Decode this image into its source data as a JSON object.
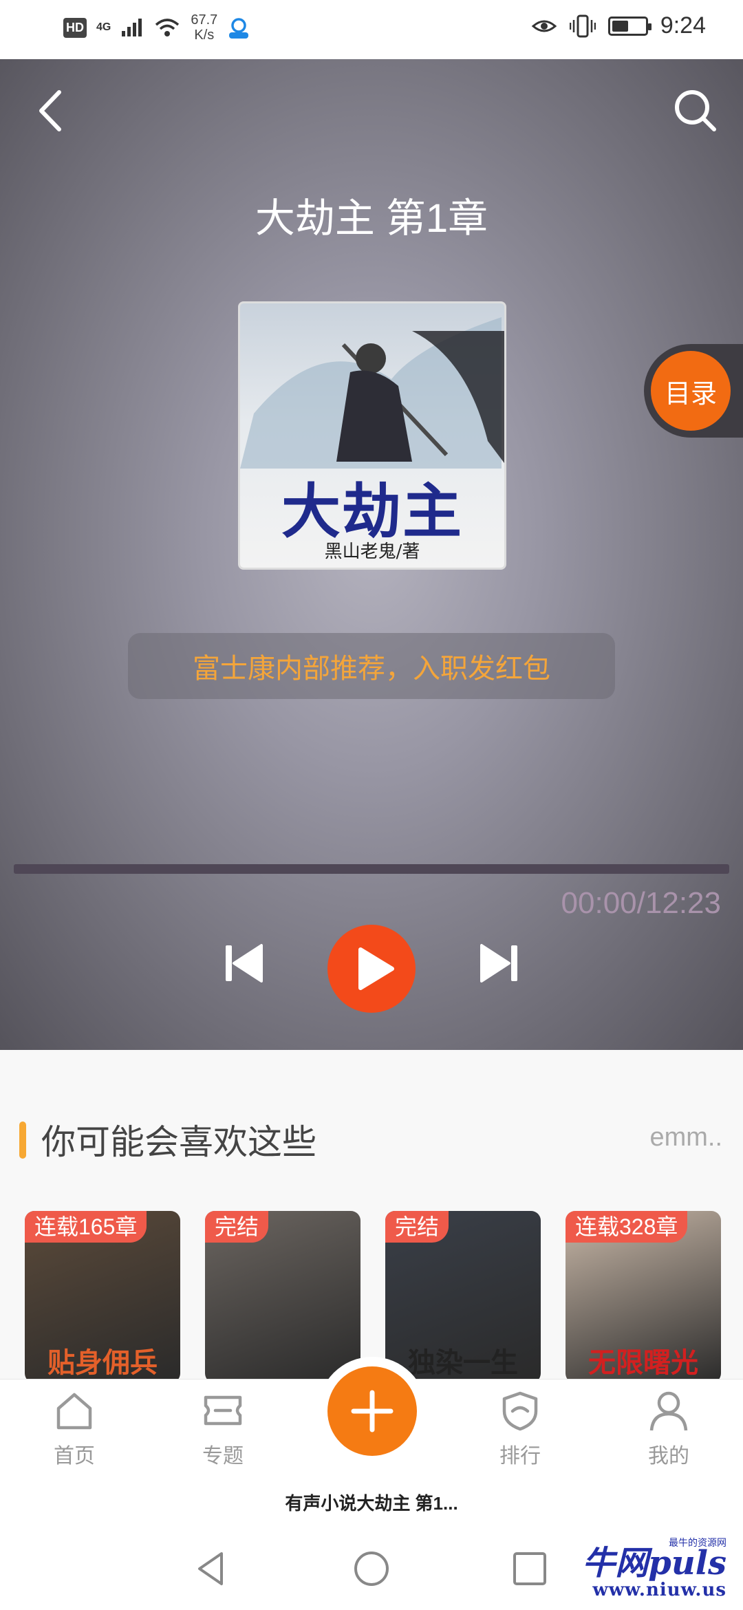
{
  "status_bar": {
    "hd": "HD",
    "network": "4G",
    "speed_value": "67.7",
    "speed_unit": "K/s",
    "time": "9:24",
    "battery_level": 0.45
  },
  "player": {
    "title": "大劫主 第1章",
    "cover": {
      "title_text": "大劫主",
      "author_text": "黑山老鬼/著"
    },
    "toc_label": "目录",
    "banner_text": "富士康内部推荐，入职发红包",
    "progress": 0,
    "time_text": "00:00/12:23",
    "colors": {
      "accent": "#f34a1a",
      "banner_text": "#f4a53a",
      "time_text": "#a993ab"
    }
  },
  "recommendations": {
    "title": "你可能会喜欢这些",
    "more": "emm..",
    "books": [
      {
        "tag": "连载165章",
        "text": "贴身佣兵",
        "bg": "#5b4a3a",
        "text_color": "#e4602a"
      },
      {
        "tag": "完结",
        "text": "",
        "bg": "#6b6560",
        "text_color": "#ffffff"
      },
      {
        "tag": "完结",
        "text": "独染一生",
        "bg": "#3a3f48",
        "text_color": "#222222"
      },
      {
        "tag": "连载328章",
        "text": "无限曙光",
        "bg": "#c9b8a8",
        "text_color": "#d22020"
      }
    ]
  },
  "bottom_nav": {
    "items": [
      {
        "label": "首页",
        "icon": "home-icon"
      },
      {
        "label": "专题",
        "icon": "ticket-icon"
      },
      {
        "label": "排行",
        "icon": "shield-icon"
      },
      {
        "label": "我的",
        "icon": "person-icon"
      }
    ],
    "fab_icon": "plus-icon"
  },
  "mini_player_title": "有声小说大劫主 第1...",
  "watermark": {
    "main": "牛网puls",
    "small": "最牛的资源网",
    "sub": "www.niuw.us"
  }
}
